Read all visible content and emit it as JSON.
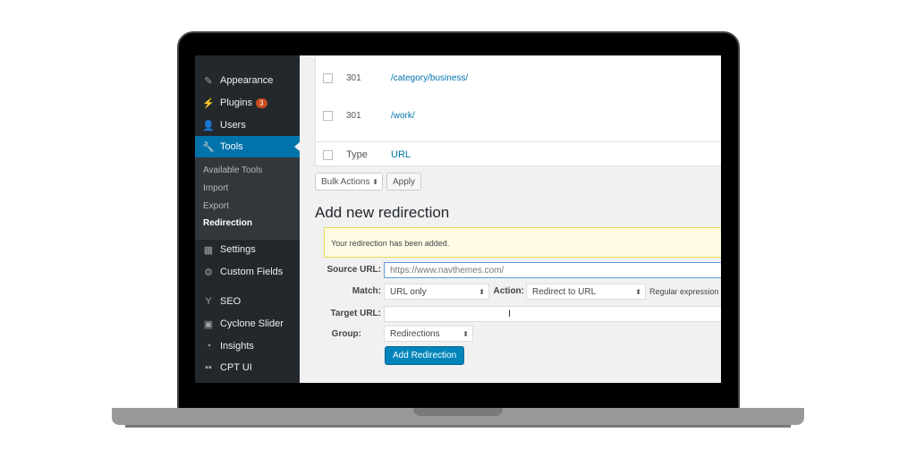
{
  "sidebar": {
    "items": [
      {
        "label": "Appearance",
        "icon": "paintbrush-icon"
      },
      {
        "label": "Plugins",
        "icon": "plugin-icon",
        "badge": "3"
      },
      {
        "label": "Users",
        "icon": "user-icon"
      },
      {
        "label": "Tools",
        "icon": "wrench-icon",
        "active": true
      },
      {
        "label": "Settings",
        "icon": "settings-icon"
      },
      {
        "label": "Custom Fields",
        "icon": "gear-icon"
      },
      {
        "label": "SEO",
        "icon": "yoast-icon"
      },
      {
        "label": "Cyclone Slider",
        "icon": "slider-icon"
      },
      {
        "label": "Insights",
        "icon": "insights-icon"
      },
      {
        "label": "CPT UI",
        "icon": "grid-icon"
      }
    ],
    "submenu": [
      "Available Tools",
      "Import",
      "Export",
      "Redirection"
    ],
    "submenu_current": "Redirection"
  },
  "table": {
    "rows": [
      {
        "code": "301",
        "url": "/category/business/"
      },
      {
        "code": "301",
        "url": "/work/"
      }
    ],
    "footer": {
      "type": "Type",
      "url": "URL"
    }
  },
  "bulk": {
    "select": "Bulk Actions",
    "apply": "Apply"
  },
  "form": {
    "title": "Add new redirection",
    "notice": "Your redirection has been added.",
    "source_label": "Source URL:",
    "source_value": "https://www.navthemes.com/",
    "match_label": "Match:",
    "match_value": "URL only",
    "action_label": "Action:",
    "action_value": "Redirect to URL",
    "regex_label": "Regular expression",
    "target_label": "Target URL:",
    "target_value": "",
    "group_label": "Group:",
    "group_value": "Redirections",
    "submit": "Add Redirection"
  },
  "colors": {
    "sidebar": "#23282d",
    "active": "#0073aa",
    "primary": "#0085ba",
    "badge": "#ca4a1f"
  }
}
